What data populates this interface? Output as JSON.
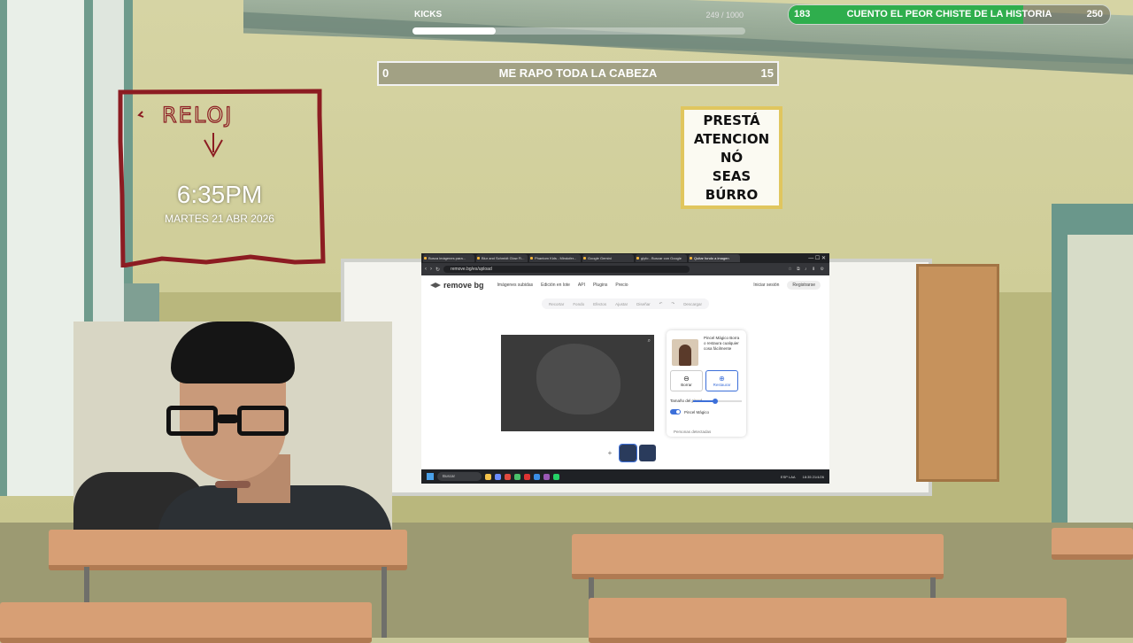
{
  "stream_overlay": {
    "kicks": {
      "label": "KICKS",
      "count": "249 / 1000",
      "progress": 0.249
    },
    "goal_bar": {
      "start": "183",
      "title": "CUENTO EL PEOR CHISTE DE LA HISTORIA",
      "end": "250",
      "progress": 0.73,
      "color": "#2fae4d"
    },
    "sub_goal": {
      "start": "0",
      "title": "ME RAPO TODA LA CABEZA",
      "end": "15"
    },
    "clock": {
      "handwritten": "RELOJ",
      "time": "6:35PM",
      "date": "MARTES 21 ABR 2026"
    },
    "sign": {
      "lines": [
        "PRESTÁ",
        "ATENCION",
        "NÓ",
        "SEAS",
        "BÚRRO"
      ]
    }
  },
  "browser": {
    "tabs": [
      {
        "label": "Busca imágenes para...",
        "active": false
      },
      {
        "label": "Blur and Schmidt Glow Fi...",
        "active": false
      },
      {
        "label": "Phantom Kids - Mindofer...",
        "active": false
      },
      {
        "label": "Google Gemini",
        "active": false
      },
      {
        "label": "glyfo - Buscar con Google",
        "active": false
      },
      {
        "label": "Quitar fondo a imagen",
        "active": true
      }
    ],
    "window_controls": "—  ☐  ✕",
    "url": "remove.bg/es/upload",
    "extensions": "☆ ⧉ ♪ ⬇ ⚙"
  },
  "site": {
    "logo": "remove bg",
    "nav": [
      "Imágenes subidas",
      "Edición en lote",
      "API",
      "Plugins",
      "Precio"
    ],
    "login": "Iniciar sesión",
    "register": "Registrarse",
    "toolbar": [
      "Recortar",
      "Fondo",
      "Efectos",
      "Ajustar",
      "Diseñar",
      "↶",
      "↷",
      "Descargar"
    ],
    "zoom_icon": "magnifier-icon",
    "panel": {
      "description": "Pincel Mágico Borra o restaura cualquier cosa fácilmente",
      "erase_label": "Borrar",
      "restore_label": "Restaurar",
      "brush_size_label": "Tamaño del pincel",
      "brush_size": 0.45,
      "magic_brush_label": "Pincel Mágico",
      "magic_brush_on": true,
      "more_label": "Personas detectadas"
    },
    "add_thumb": "+"
  },
  "taskbar": {
    "search": "Buscar",
    "language": "ESP LAA",
    "clock": "18:35 21/4/26"
  }
}
